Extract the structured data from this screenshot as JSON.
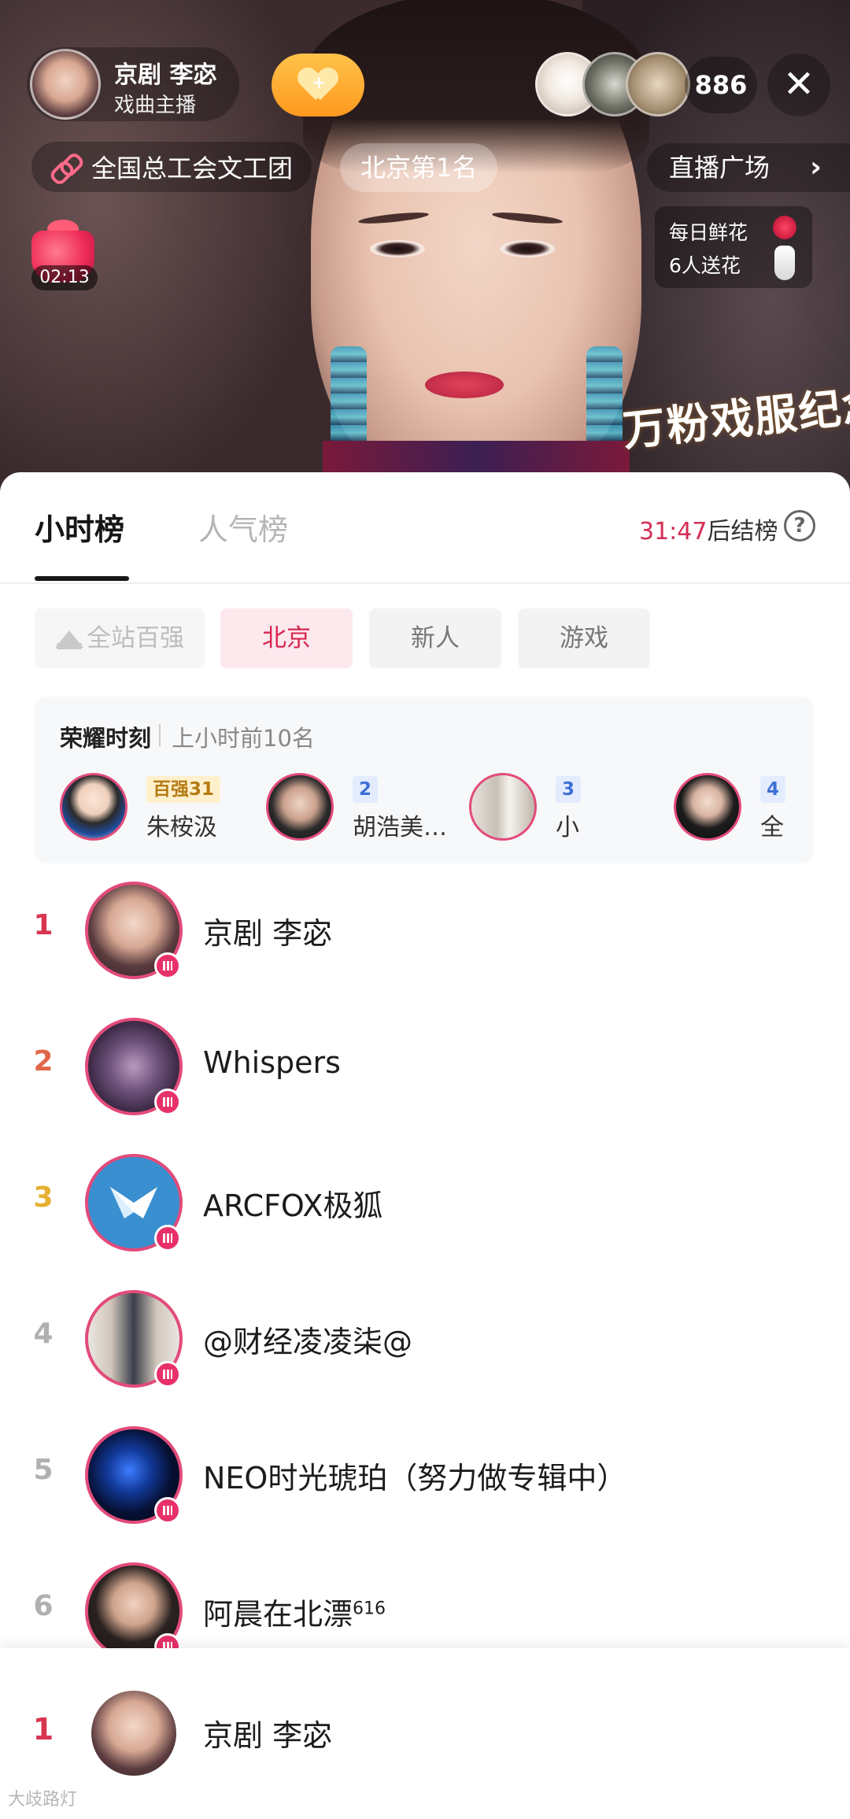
{
  "stream": {
    "overlay_text": "万粉戏服纪念直播"
  },
  "header": {
    "anchor_name": "京剧 李宓",
    "anchor_subtitle": "戏曲主播",
    "follow_icon": "heart-plus-icon",
    "viewer_count": "886",
    "close_label": "✕",
    "union_name": "全国总工会文工团",
    "city_rank": "北京第1名",
    "plaza_label": "直播广场",
    "gift_timer": "02:13",
    "flower_line1": "每日鲜花",
    "flower_line2": "6人送花"
  },
  "tabs": [
    {
      "label": "小时榜",
      "active": true
    },
    {
      "label": "人气榜",
      "active": false
    }
  ],
  "countdown": {
    "time": "31:47",
    "suffix": "后结榜",
    "help_label": "?"
  },
  "filters": [
    {
      "label": "全站百强",
      "icon": "crown-icon",
      "state": "disabled"
    },
    {
      "label": "北京",
      "state": "selected"
    },
    {
      "label": "新人",
      "state": "normal"
    },
    {
      "label": "游戏",
      "state": "normal"
    }
  ],
  "glory": {
    "title": "荣耀时刻",
    "subtitle": "上小时前10名",
    "items": [
      {
        "badge": "百强31",
        "name": "朱桉汲"
      },
      {
        "badge": "2",
        "name": "胡浩美…"
      },
      {
        "badge": "3",
        "name": "小"
      },
      {
        "badge": "4",
        "name": "全"
      }
    ]
  },
  "ranking": [
    {
      "rank": "1",
      "name": "京剧 李宓"
    },
    {
      "rank": "2",
      "name": "Whispers"
    },
    {
      "rank": "3",
      "name": "ARCFOX极狐"
    },
    {
      "rank": "4",
      "name": "@财经凌凌柒@"
    },
    {
      "rank": "5",
      "name": "NEO时光琥珀（努力做专辑中）"
    },
    {
      "rank": "6",
      "name": "阿晨在北漂",
      "sup": "616"
    }
  ],
  "self_entry": {
    "rank": "1",
    "name": "京剧 李宓"
  },
  "credit": "大歧路灯",
  "colors": {
    "accent": "#d8264f",
    "rank1": "#d83650",
    "rank2": "#e0674a",
    "rank3": "#e6b030",
    "rank_other": "#b0b0b0",
    "follow": "#ffa52c"
  }
}
